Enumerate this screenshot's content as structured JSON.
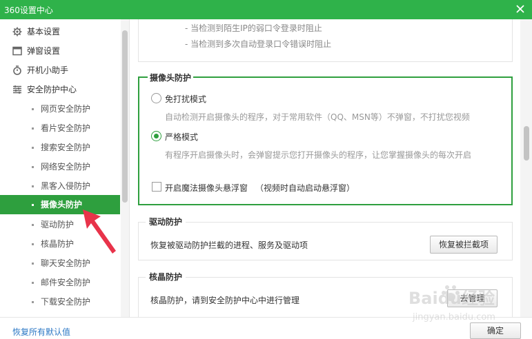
{
  "window": {
    "title": "360设置中心"
  },
  "sidebar": {
    "items": [
      {
        "label": "基本设置",
        "icon": "gear-icon"
      },
      {
        "label": "弹窗设置",
        "icon": "window-icon"
      },
      {
        "label": "开机小助手",
        "icon": "timer-icon"
      },
      {
        "label": "安全防护中心",
        "icon": "list-icon"
      }
    ],
    "sub_items": [
      {
        "label": "网页安全防护"
      },
      {
        "label": "看片安全防护"
      },
      {
        "label": "搜索安全防护"
      },
      {
        "label": "网络安全防护"
      },
      {
        "label": "黑客入侵防护"
      },
      {
        "label": "摄像头防护",
        "active": true
      },
      {
        "label": "驱动防护"
      },
      {
        "label": "核晶防护"
      },
      {
        "label": "聊天安全防护"
      },
      {
        "label": "邮件安全防护"
      },
      {
        "label": "下载安全防护"
      }
    ]
  },
  "main": {
    "top_box": {
      "lines": [
        "- 当检测到陌生IP的弱口令登录时阻止",
        "- 当检测到多次自动登录口令错误时阻止"
      ]
    },
    "camera": {
      "title": "摄像头防护",
      "option1_label": "免打扰模式",
      "option1_desc": "自动检测开启摄像头的程序，对于常用软件（QQ、MSN等）不弹窗，不打扰您视频",
      "option2_label": "严格模式",
      "option2_desc": "有程序开启摄像头时，会弹窗提示您打开摄像头的程序，让您掌握摄像头的每次开启",
      "selected": "严格模式",
      "checkbox_label": "开启魔法摄像头悬浮窗",
      "checkbox_note": "（视频时自动启动悬浮窗）",
      "checkbox_checked": false
    },
    "driver": {
      "title": "驱动防护",
      "text": "恢复被驱动防护拦截的进程、服务及驱动项",
      "button": "恢复被拦截项"
    },
    "kernel": {
      "title": "核晶防护",
      "text": "核晶防护，请到安全防护中心中进行管理",
      "button": "去管理"
    }
  },
  "footer": {
    "restore_label": "恢复所有默认值",
    "ok_label": "确定"
  },
  "watermark": {
    "brand": "Baidu经验",
    "url": "jingyan.baidu.com"
  },
  "colors": {
    "title_bar": "#2fb24a",
    "accent": "#2e9f3e",
    "link": "#2c78c5",
    "annotation_arrow": "#e8334a"
  }
}
